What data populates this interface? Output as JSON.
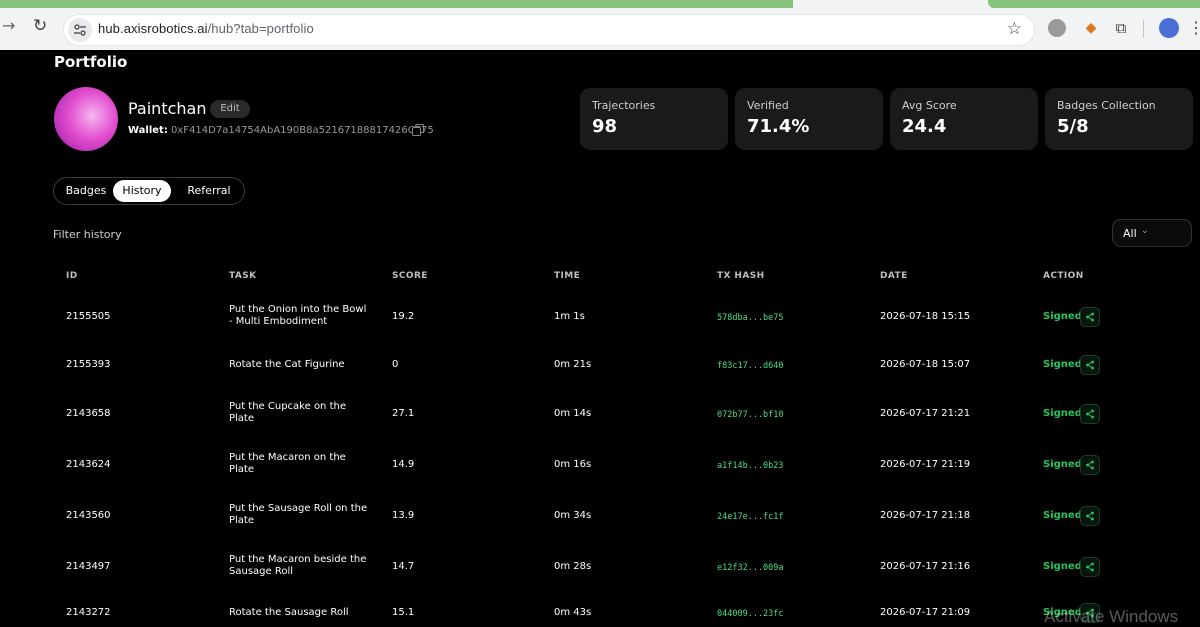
{
  "browser": {
    "url_host": "hub.axisrobotics.ai",
    "url_path": "/hub?tab=portfolio"
  },
  "page_title": "Portfolio",
  "profile": {
    "username": "Paintchan",
    "edit_label": "Edit",
    "wallet_label": "Wallet:",
    "wallet_address": "0xF414D7a14754AbA190B8a52167188817426C775"
  },
  "stats": [
    {
      "label": "Trajectories",
      "value": "98"
    },
    {
      "label": "Verified",
      "value": "71.4%"
    },
    {
      "label": "Avg Score",
      "value": "24.4"
    },
    {
      "label": "Badges Collection",
      "value": "5/8"
    }
  ],
  "tabs": [
    {
      "label": "Badges"
    },
    {
      "label": "History",
      "active": true
    },
    {
      "label": "Referral"
    }
  ],
  "filter": {
    "label": "Filter history",
    "selected": "All"
  },
  "table": {
    "headers": [
      "ID",
      "TASK",
      "SCORE",
      "TIME",
      "TX HASH",
      "DATE",
      "ACTION"
    ],
    "rows": [
      {
        "id": "2155505",
        "task": "Put the Onion into the Bowl - Multi Embodiment",
        "score": "19.2",
        "time": "1m 1s",
        "hash": "578dba...be75",
        "date": "2026-07-18 15:15",
        "action": "Signed"
      },
      {
        "id": "2155393",
        "task": "Rotate the Cat Figurine",
        "score": "0",
        "time": "0m 21s",
        "hash": "f83c17...d640",
        "date": "2026-07-18 15:07",
        "action": "Signed"
      },
      {
        "id": "2143658",
        "task": "Put the Cupcake on the Plate",
        "score": "27.1",
        "time": "0m 14s",
        "hash": "072b77...bf10",
        "date": "2026-07-17 21:21",
        "action": "Signed"
      },
      {
        "id": "2143624",
        "task": "Put the Macaron on the Plate",
        "score": "14.9",
        "time": "0m 16s",
        "hash": "a1f14b...0b23",
        "date": "2026-07-17 21:19",
        "action": "Signed"
      },
      {
        "id": "2143560",
        "task": "Put the Sausage Roll on the Plate",
        "score": "13.9",
        "time": "0m 34s",
        "hash": "24e17e...fc1f",
        "date": "2026-07-17 21:18",
        "action": "Signed"
      },
      {
        "id": "2143497",
        "task": "Put the Macaron beside the Sausage Roll",
        "score": "14.7",
        "time": "0m 28s",
        "hash": "e12f32...009a",
        "date": "2026-07-17 21:16",
        "action": "Signed"
      },
      {
        "id": "2143272",
        "task": "Rotate the Sausage Roll",
        "score": "15.1",
        "time": "0m 43s",
        "hash": "044009...23fc",
        "date": "2026-07-17 21:09",
        "action": "Signed"
      }
    ]
  },
  "watermark": "Activate Windows",
  "colors": {
    "accent_green": "#22c55e",
    "hash_green": "#4ade80",
    "background": "#000000",
    "card": "#1a1a1a"
  }
}
